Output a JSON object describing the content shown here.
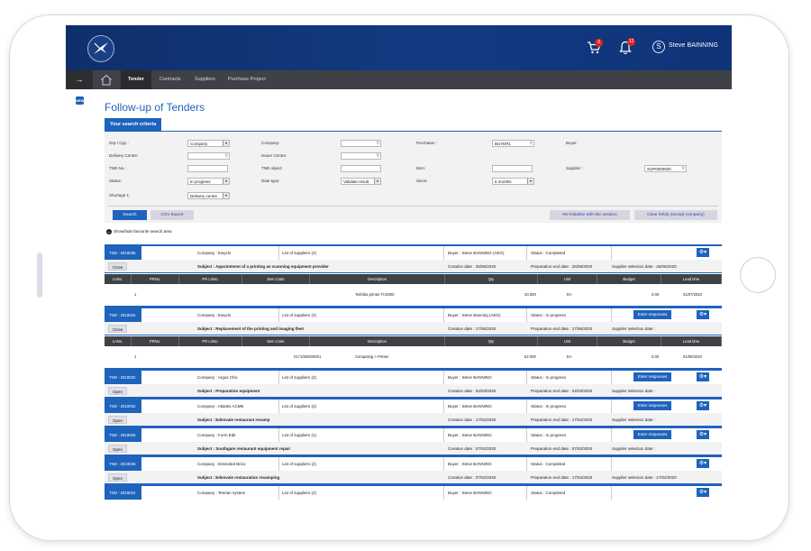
{
  "header": {
    "cart_count": "3",
    "notif_count": "12",
    "user_initial": "S",
    "user_name": "Steve BAINNING"
  },
  "nav": {
    "back": "→",
    "items": [
      "Tender",
      "Contracts",
      "Suppliers",
      "Purchase Project"
    ]
  },
  "page": {
    "title": "Follow-up of Tenders",
    "criteria_tab": "Your search criteria",
    "show_hide": "Show/hide favourite search area"
  },
  "criteria": {
    "grp_label": "Grp / Cpy :",
    "grp_value": "Company",
    "company_label": "Company:",
    "purchaser_label": "Purchaser :",
    "purchaser_value": "BUYER1",
    "buyer_label": "Buyer:",
    "delivery_label": "Delivery Centre:",
    "issuer_label": "Issuer Centre:",
    "tnd_no_label": "TND No.:",
    "tnd_object_label": "TND object:",
    "item_label": "Item:",
    "supplier_label": "Supplier :",
    "supplier_value": "SUP0000825",
    "status_label": "Status:",
    "status_value": "In progress",
    "date_type_label": "Date type:",
    "date_type_value": "Validate result",
    "since_label": "Since:",
    "since_value": "6 months",
    "shortage_label": "Shortage 1:",
    "shortage_value": "Delivery centre"
  },
  "buttons": {
    "search": "Search",
    "csv": "CSV Export",
    "reinit": "Re-initialise with the session",
    "clear": "Clear fields (except company)"
  },
  "items_headers": [
    "LnNo.",
    "PRNo.",
    "PR LnNo.",
    "Item Code",
    "Description",
    "Qty",
    "Unit",
    "Budget",
    "Lead time"
  ],
  "tenders": [
    {
      "id": "TND - 2019035",
      "company": "Company : Ewyclo",
      "suppliers": "List of suppliers (2)",
      "buyer": "Buyer : Steve BANNING (AEG)",
      "status": "Status : Completed",
      "enter": "",
      "toggle": "Close",
      "subject": "Subject : Appointment of a printing an scanning equipment provider",
      "creation": "Creation date : 26/06/2020",
      "prep_end": "Preparation end date : 26/06/2020",
      "supplier_sel": "Supplier selection date : 26/06/2020",
      "item": {
        "lnno": "1",
        "prno": "",
        "prlnno": "",
        "code": "",
        "desc": "Toshiba printer TH3000",
        "qty": "30.000",
        "unit": "EA",
        "budget": "0.00",
        "lead": "31/07/2020"
      }
    },
    {
      "id": "TND - 2019034",
      "company": "Company : Ewyclo",
      "suppliers": "List of suppliers (2)",
      "buyer": "Buyer : Steve Banning (AEG)",
      "status": "Status : In progress",
      "enter": "Enter responses",
      "toggle": "Close",
      "subject": "Subject : Replacement of the printing and imaging fleet",
      "creation": "Creation date : 17/06/2020",
      "prep_end": "Preparation end date : 17/06/2020",
      "supplier_sel": "Supplier selection date :",
      "item": {
        "lnno": "1",
        "prno": "",
        "prlnno": "",
        "code": "0171000200001",
        "desc": "Computing > Printer",
        "qty": "52.000",
        "unit": "EA",
        "budget": "0.00",
        "lead": "01/09/2020"
      }
    },
    {
      "id": "TND - 2019032",
      "company": "Company : Argos Chic",
      "suppliers": "List of suppliers (2)",
      "buyer": "Buyer : Steve BANNING",
      "status": "Status : In progress",
      "enter": "Enter responses",
      "toggle": "Open",
      "subject": "Subject : Preparation equipment",
      "creation": "Creation date : 04/03/2020",
      "prep_end": "Preparation end date : 04/03/2020",
      "supplier_sel": "Supplier selection date :"
    },
    {
      "id": "TND - 2019032",
      "company": "Company : Atlantis ACME",
      "suppliers": "List of suppliers (2)",
      "buyer": "Buyer : Steve BANNING",
      "status": "Status : In progress",
      "enter": "Enter responses",
      "toggle": "Open",
      "subject": "Subject : Edenvale restaurant revamp",
      "creation": "Creation date : 17/02/2020",
      "prep_end": "Preparation end date : 17/02/2020",
      "supplier_sel": "Supplier selection date :"
    },
    {
      "id": "TND - 2019026",
      "company": "Company : Form Edit",
      "suppliers": "List of suppliers (1)",
      "buyer": "Buyer : Steve BANNING",
      "status": "Status : In progress",
      "enter": "Enter responses",
      "toggle": "Open",
      "subject": "Subject : Southgate restaurant equipment repair",
      "creation": "Creation date : 07/02/2020",
      "prep_end": "Preparation end date : 07/02/2020",
      "supplier_sel": "Supplier selection date :"
    },
    {
      "id": "TND - 2019025",
      "company": "Company : Extended Brico",
      "suppliers": "List of suppliers (2)",
      "buyer": "Buyer : Steve BANNING",
      "status": "Status : Completed",
      "enter": "",
      "toggle": "Open",
      "subject": "Subject : Edenvale restauration revamping",
      "creation": "Creation date : 07/02/2020",
      "prep_end": "Preparation end date : 17/02/2020",
      "supplier_sel": "Supplier selection date : 17/02/2020"
    },
    {
      "id": "TND - 2019024",
      "company": "Company : Teerian system",
      "suppliers": "List of suppliers (2)",
      "buyer": "Buyer : Steve BANNING",
      "status": "Status : Completed",
      "enter": "",
      "toggle": "",
      "subject": "",
      "creation": "",
      "prep_end": "",
      "supplier_sel": ""
    }
  ]
}
